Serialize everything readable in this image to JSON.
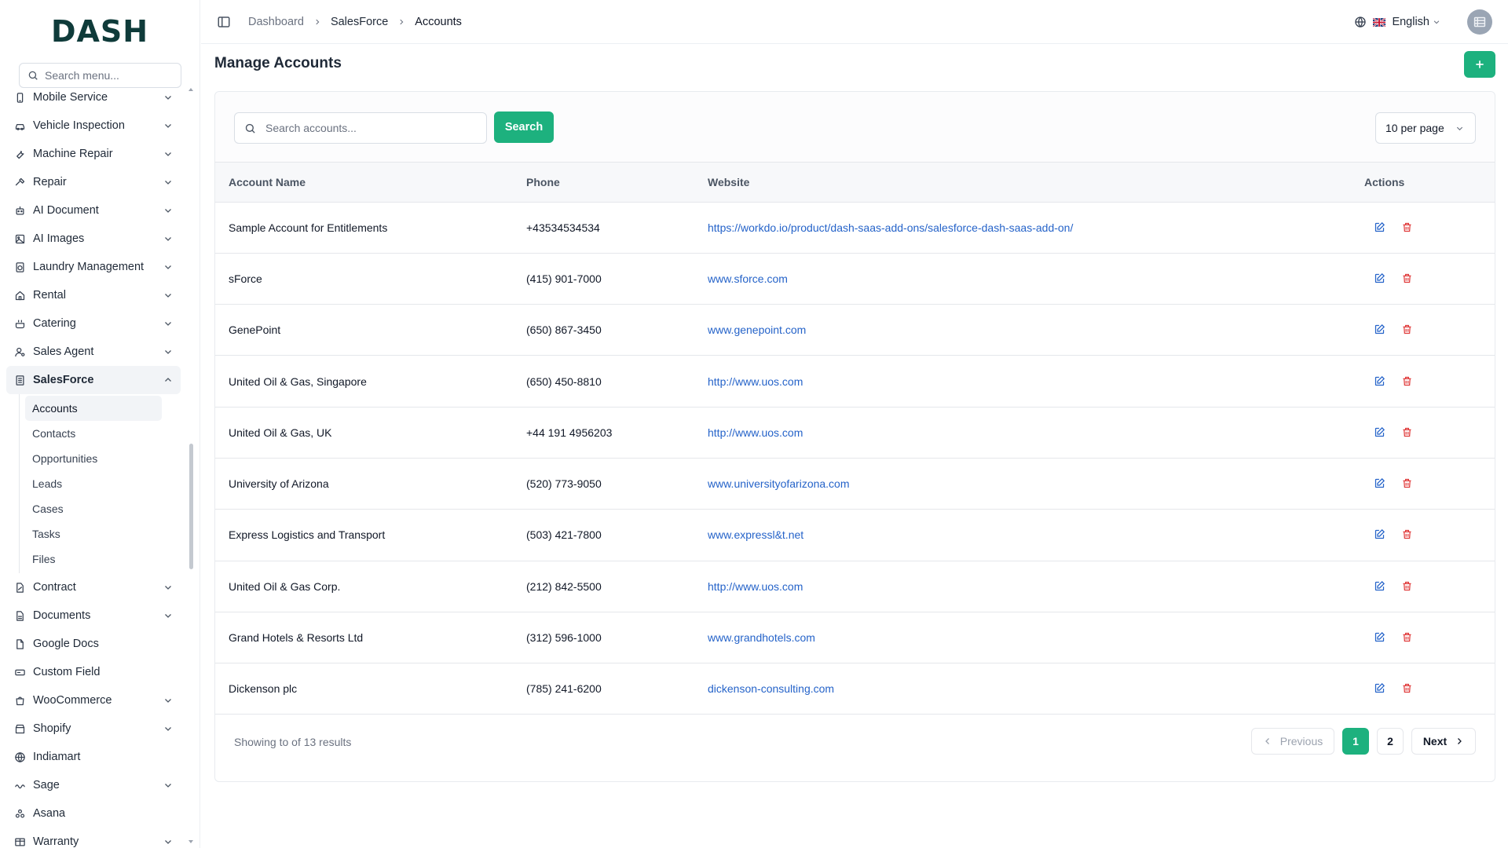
{
  "brand": {
    "logo_text": "DASH"
  },
  "sidebar": {
    "search_placeholder": "Search menu...",
    "items": [
      {
        "label": "Mobile Service",
        "icon": "phone-icon",
        "expandable": true
      },
      {
        "label": "Vehicle Inspection",
        "icon": "car-icon",
        "expandable": true
      },
      {
        "label": "Machine Repair",
        "icon": "wrench-icon",
        "expandable": true
      },
      {
        "label": "Repair",
        "icon": "hammer-icon",
        "expandable": true
      },
      {
        "label": "AI Document",
        "icon": "robot-icon",
        "expandable": true
      },
      {
        "label": "AI Images",
        "icon": "image-icon",
        "expandable": true
      },
      {
        "label": "Laundry Management",
        "icon": "washer-icon",
        "expandable": true
      },
      {
        "label": "Rental",
        "icon": "home-icon",
        "expandable": true
      },
      {
        "label": "Catering",
        "icon": "cooking-pot-icon",
        "expandable": true
      },
      {
        "label": "Sales Agent",
        "icon": "user-cog-icon",
        "expandable": true
      },
      {
        "label": "SalesForce",
        "icon": "building-icon",
        "expandable": true,
        "expanded": true
      },
      {
        "label": "Contract",
        "icon": "file-pen-icon",
        "expandable": true
      },
      {
        "label": "Documents",
        "icon": "file-text-icon",
        "expandable": true
      },
      {
        "label": "Google Docs",
        "icon": "file-icon",
        "expandable": false
      },
      {
        "label": "Custom Field",
        "icon": "form-field-icon",
        "expandable": false
      },
      {
        "label": "WooCommerce",
        "icon": "shopping-bag-icon",
        "expandable": true
      },
      {
        "label": "Shopify",
        "icon": "store-icon",
        "expandable": true
      },
      {
        "label": "Indiamart",
        "icon": "globe-icon",
        "expandable": false
      },
      {
        "label": "Sage",
        "icon": "sage-icon",
        "expandable": true
      },
      {
        "label": "Asana",
        "icon": "asana-icon",
        "expandable": false
      },
      {
        "label": "Warranty",
        "icon": "table-icon",
        "expandable": true
      }
    ],
    "salesforce_sub": [
      "Accounts",
      "Contacts",
      "Opportunities",
      "Leads",
      "Cases",
      "Tasks",
      "Files"
    ],
    "active_sub": "Accounts"
  },
  "header": {
    "breadcrumb": [
      "Dashboard",
      "SalesForce",
      "Accounts"
    ],
    "language": "English"
  },
  "main": {
    "title": "Manage Accounts",
    "search_placeholder": "Search accounts...",
    "search_button": "Search",
    "per_page": "10 per page",
    "columns": [
      "Account Name",
      "Phone",
      "Website",
      "Actions"
    ],
    "rows": [
      {
        "name": "Sample Account for Entitlements",
        "phone": "+43534534534",
        "website": "https://workdo.io/product/dash-saas-add-ons/salesforce-dash-saas-add-on/"
      },
      {
        "name": "sForce",
        "phone": "(415) 901-7000",
        "website": "www.sforce.com"
      },
      {
        "name": "GenePoint",
        "phone": "(650) 867-3450",
        "website": "www.genepoint.com"
      },
      {
        "name": "United Oil & Gas, Singapore",
        "phone": "(650) 450-8810",
        "website": "http://www.uos.com"
      },
      {
        "name": "United Oil & Gas, UK",
        "phone": "+44 191 4956203",
        "website": "http://www.uos.com"
      },
      {
        "name": "University of Arizona",
        "phone": "(520) 773-9050",
        "website": "www.universityofarizona.com"
      },
      {
        "name": "Express Logistics and Transport",
        "phone": "(503) 421-7800",
        "website": "www.expressl&t.net"
      },
      {
        "name": "United Oil & Gas Corp.",
        "phone": "(212) 842-5500",
        "website": "http://www.uos.com"
      },
      {
        "name": "Grand Hotels & Resorts Ltd",
        "phone": "(312) 596-1000",
        "website": "www.grandhotels.com"
      },
      {
        "name": "Dickenson plc",
        "phone": "(785) 241-6200",
        "website": "dickenson-consulting.com"
      }
    ],
    "footer": {
      "showing": "Showing to of 13 results",
      "prev": "Previous",
      "pages": [
        "1",
        "2"
      ],
      "current_page": "1",
      "next": "Next"
    }
  },
  "colors": {
    "accent": "#1db17e",
    "link": "#2563c9",
    "danger": "#e03b3b"
  }
}
